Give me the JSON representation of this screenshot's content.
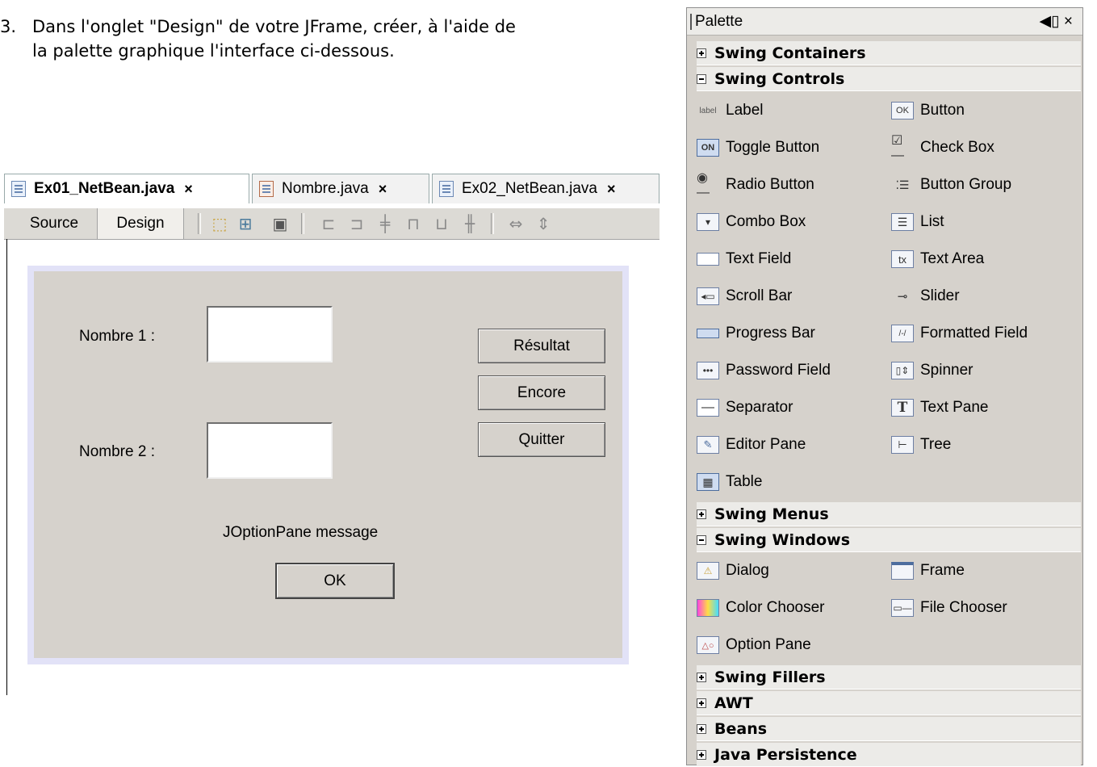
{
  "instruction": {
    "number": "3.",
    "line1": "Dans l'onglet \"Design\" de votre JFrame, créer, à l'aide de",
    "line2": "la palette graphique l'interface ci-dessous."
  },
  "editor": {
    "tabs": [
      {
        "label": "Ex01_NetBean.java",
        "close": "×",
        "active": true
      },
      {
        "label": "Nombre.java",
        "close": "×",
        "active": false
      },
      {
        "label": "Ex02_NetBean.java",
        "close": "×",
        "active": false
      }
    ],
    "toolbar": {
      "source": "Source",
      "design": "Design"
    }
  },
  "form": {
    "label1": "Nombre 1 :",
    "label2": "Nombre 2 :",
    "buttons": {
      "resultat": "Résultat",
      "encore": "Encore",
      "quitter": "Quitter"
    },
    "message": "JOptionPane message",
    "ok": "OK"
  },
  "palette": {
    "title": "Palette",
    "controls": "◀▯ ×",
    "categories": {
      "containers": "Swing Containers",
      "controls": "Swing Controls",
      "menus": "Swing Menus",
      "windows": "Swing Windows",
      "fillers": "Swing Fillers",
      "awt": "AWT",
      "beans": "Beans",
      "persistence": "Java Persistence"
    },
    "controls_items": [
      "Label",
      "Button",
      "Toggle Button",
      "Check Box",
      "Radio Button",
      "Button Group",
      "Combo Box",
      "List",
      "Text Field",
      "Text Area",
      "Scroll Bar",
      "Slider",
      "Progress Bar",
      "Formatted Field",
      "Password Field",
      "Spinner",
      "Separator",
      "Text Pane",
      "Editor Pane",
      "Tree",
      "Table"
    ],
    "windows_items": [
      "Dialog",
      "Frame",
      "Color Chooser",
      "File Chooser",
      "Option Pane"
    ],
    "icon_labels": {
      "label": "label",
      "ok": "OK",
      "on": "ON",
      "tx": "tx",
      "t": "T"
    }
  }
}
